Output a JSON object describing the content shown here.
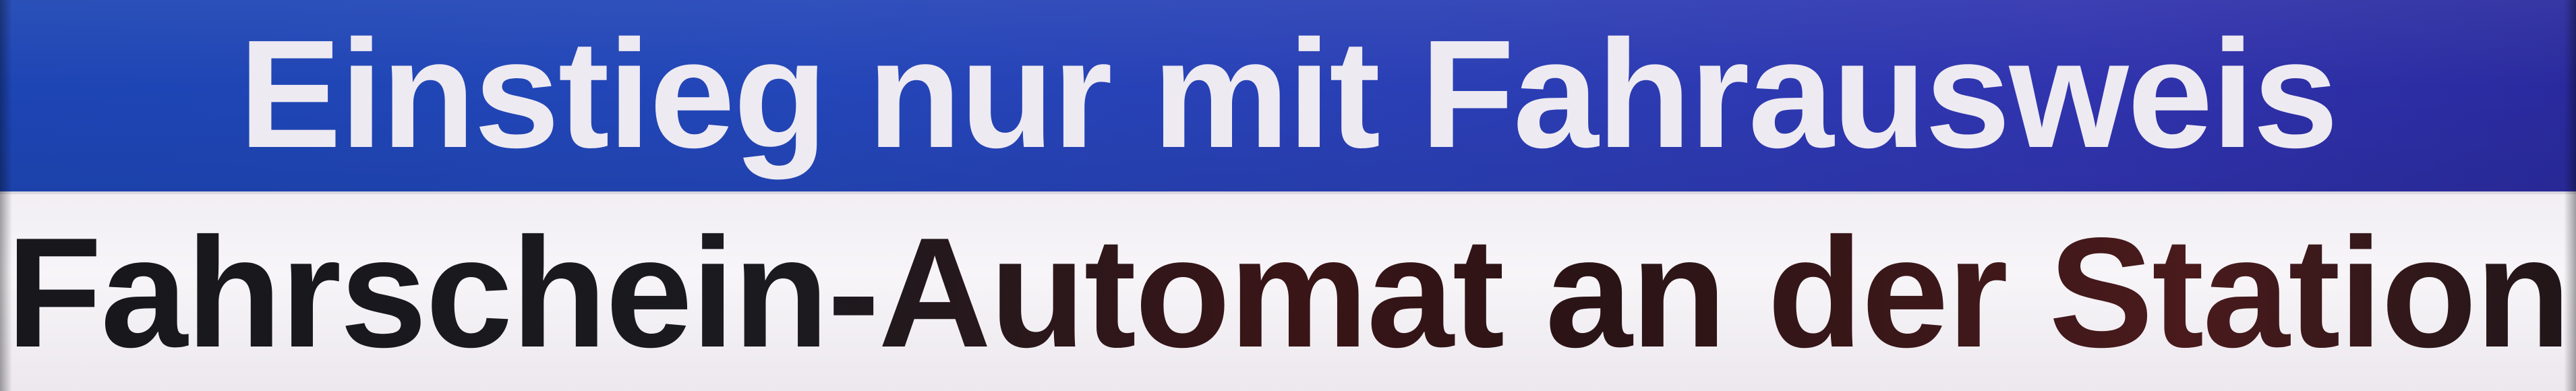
{
  "sign": {
    "headline": "Einstieg nur mit Fahrausweis",
    "subline": "Fahrschein-Automat an der Station"
  },
  "colors": {
    "top_band": "#2346b8",
    "headline_text": "#eeeaf2",
    "bottom_band": "#f4f2f6",
    "subline_text": "#1a1a1f"
  }
}
